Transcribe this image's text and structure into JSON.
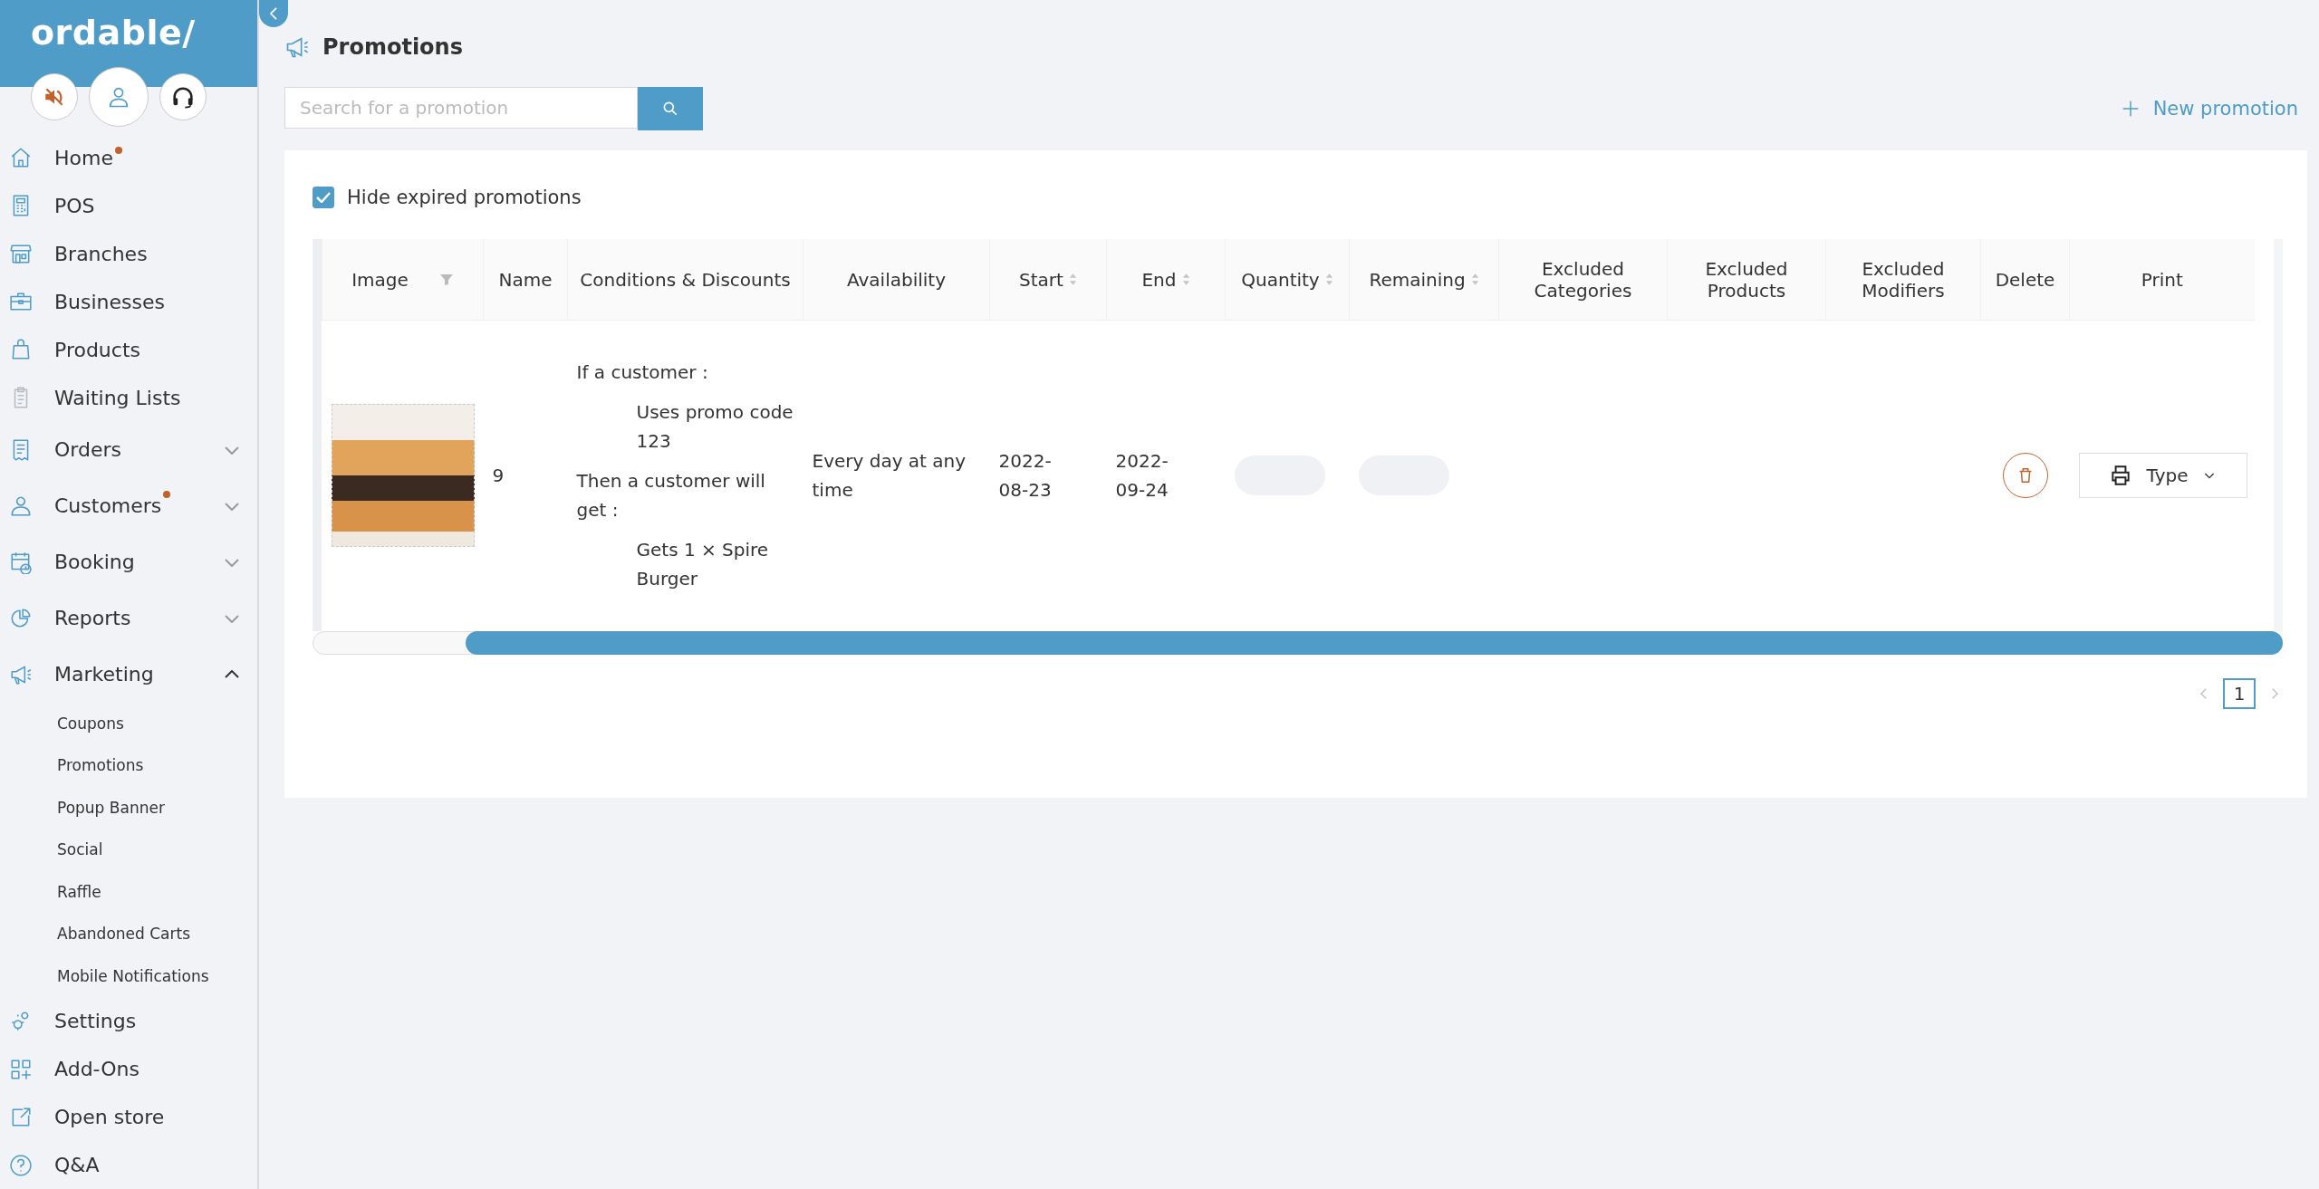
{
  "sidebar": {
    "logo": "ordable/",
    "nav": [
      {
        "label": "Home",
        "dot": true
      },
      {
        "label": "POS",
        "dot": false
      },
      {
        "label": "Branches",
        "dot": false
      },
      {
        "label": "Businesses",
        "dot": false
      },
      {
        "label": "Products",
        "dot": false
      },
      {
        "label": "Waiting Lists",
        "dot": false
      },
      {
        "label": "Orders",
        "dot": false,
        "expanded": false
      },
      {
        "label": "Customers",
        "dot": true,
        "expanded": false
      },
      {
        "label": "Booking",
        "dot": false,
        "expanded": false
      },
      {
        "label": "Reports",
        "dot": false,
        "expanded": false
      },
      {
        "label": "Marketing",
        "dot": false,
        "expanded": true,
        "children": [
          {
            "label": "Coupons"
          },
          {
            "label": "Promotions"
          },
          {
            "label": "Popup Banner"
          },
          {
            "label": "Social"
          },
          {
            "label": "Raffle"
          },
          {
            "label": "Abandoned Carts"
          },
          {
            "label": "Mobile Notifications"
          }
        ]
      },
      {
        "label": "Settings",
        "dot": false
      },
      {
        "label": "Add-Ons",
        "dot": false
      },
      {
        "label": "Open store",
        "dot": false
      },
      {
        "label": "Q&A",
        "dot": false
      }
    ]
  },
  "page": {
    "title": "Promotions",
    "search": {
      "placeholder": "Search for a promotion"
    },
    "new_button": "New promotion"
  },
  "hide_expired": {
    "label": "Hide expired promotions",
    "checked": true
  },
  "table": {
    "columns": [
      {
        "label": "Image",
        "kind": "filter"
      },
      {
        "label": "Name",
        "kind": "plain"
      },
      {
        "label": "Conditions & Discounts",
        "kind": "plain"
      },
      {
        "label": "Availability",
        "kind": "plain"
      },
      {
        "label": "Start",
        "kind": "sort"
      },
      {
        "label": "End",
        "kind": "sort"
      },
      {
        "label": "Quantity",
        "kind": "sort"
      },
      {
        "label": "Remaining",
        "kind": "sort"
      },
      {
        "label": "Excluded Categories",
        "kind": "plain"
      },
      {
        "label": "Excluded Products",
        "kind": "plain"
      },
      {
        "label": "Excluded Modifiers",
        "kind": "plain"
      },
      {
        "label": "Delete",
        "kind": "plain"
      },
      {
        "label": "Print",
        "kind": "plain"
      }
    ],
    "rows": [
      {
        "name": "9",
        "conditions": [
          {
            "text": "If a customer :",
            "kind": "heading"
          },
          {
            "text": "Uses promo code 123",
            "kind": "item"
          },
          {
            "text": "Then a customer will get :",
            "kind": "heading"
          },
          {
            "text": "Gets 1 × Spire Burger",
            "kind": "item"
          }
        ],
        "availability": "Every day at any time",
        "start": "2022-08-23",
        "end": "2022-09-24",
        "print_type": "Type"
      }
    ]
  },
  "pagination": {
    "pages": [
      {
        "label": "1",
        "selected": true
      }
    ]
  }
}
